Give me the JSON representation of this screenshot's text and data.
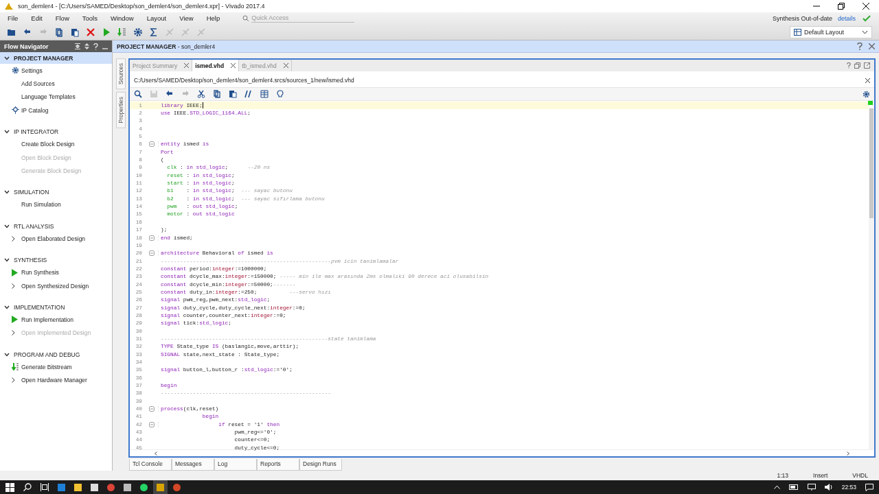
{
  "window": {
    "title": "son_demler4 - [C:/Users/SAMED/Desktop/son_demler4/son_demler4.xpr] - Vivado 2017.4"
  },
  "menu": [
    "File",
    "Edit",
    "Flow",
    "Tools",
    "Window",
    "Layout",
    "View",
    "Help"
  ],
  "quick_access": {
    "placeholder": "Quick Access"
  },
  "status": {
    "text": "Synthesis Out-of-date",
    "link": "details"
  },
  "layout_dropdown": {
    "value": "Default Layout"
  },
  "flow_navigator": {
    "title": "Flow Navigator",
    "sections": [
      {
        "title": "PROJECT MANAGER",
        "selected": true,
        "expanded": true,
        "items": [
          {
            "label": "Settings",
            "kind": "gear",
            "disabled": false
          },
          {
            "label": "Add Sources",
            "kind": "plain",
            "disabled": false
          },
          {
            "label": "Language Templates",
            "kind": "plain",
            "disabled": false
          },
          {
            "label": "IP Catalog",
            "kind": "ip",
            "disabled": false
          }
        ]
      },
      {
        "title": "IP INTEGRATOR",
        "selected": false,
        "expanded": true,
        "items": [
          {
            "label": "Create Block Design",
            "kind": "plain",
            "disabled": false
          },
          {
            "label": "Open Block Design",
            "kind": "plain",
            "disabled": true
          },
          {
            "label": "Generate Block Design",
            "kind": "plain",
            "disabled": true
          }
        ]
      },
      {
        "title": "SIMULATION",
        "selected": false,
        "expanded": true,
        "items": [
          {
            "label": "Run Simulation",
            "kind": "plain",
            "disabled": false
          }
        ]
      },
      {
        "title": "RTL ANALYSIS",
        "selected": false,
        "expanded": true,
        "items": [
          {
            "label": "Open Elaborated Design",
            "kind": "chevron",
            "disabled": false
          }
        ]
      },
      {
        "title": "SYNTHESIS",
        "selected": false,
        "expanded": true,
        "items": [
          {
            "label": "Run Synthesis",
            "kind": "play",
            "disabled": false
          },
          {
            "label": "Open Synthesized Design",
            "kind": "chevron",
            "disabled": false
          }
        ]
      },
      {
        "title": "IMPLEMENTATION",
        "selected": false,
        "expanded": true,
        "items": [
          {
            "label": "Run Implementation",
            "kind": "play",
            "disabled": false
          },
          {
            "label": "Open Implemented Design",
            "kind": "chevron",
            "disabled": true
          }
        ]
      },
      {
        "title": "PROGRAM AND DEBUG",
        "selected": false,
        "expanded": true,
        "items": [
          {
            "label": "Generate Bitstream",
            "kind": "bitstream",
            "disabled": false
          },
          {
            "label": "Open Hardware Manager",
            "kind": "chevron",
            "disabled": false
          }
        ]
      }
    ]
  },
  "panel": {
    "title": "**PROJECT MANAGER** - son_demler4"
  },
  "side_tabs": [
    "Sources",
    "Properties"
  ],
  "editor": {
    "tabs": [
      {
        "label": "Project Summary",
        "selected": false
      },
      {
        "label": "ismed.vhd",
        "selected": true
      },
      {
        "label": "tb_ismed.vhd",
        "selected": false
      }
    ],
    "path": "C:/Users/SAMED/Desktop/son_demler4/son_demler4.srcs/sources_1/new/ismed.vhd",
    "lines": [
      {
        "number": "1",
        "fold": false,
        "current": true,
        "tokens": [
          {
            "kind": "kw",
            "text": "library"
          },
          {
            "kind": "plain",
            "text": " IEEE;"
          }
        ]
      },
      {
        "number": "2",
        "fold": false,
        "current": false,
        "tokens": [
          {
            "kind": "kw",
            "text": "use"
          },
          {
            "kind": "plain",
            "text": " IEEE."
          },
          {
            "kind": "kw",
            "text": "STD_LOGIC_1164.ALL"
          },
          {
            "kind": "plain",
            "text": ";"
          }
        ]
      },
      {
        "number": "3",
        "fold": false,
        "current": false
      },
      {
        "number": "4",
        "fold": false,
        "current": false
      },
      {
        "number": "5",
        "fold": false,
        "current": false
      },
      {
        "number": "6",
        "fold": true,
        "current": false,
        "tokens": [
          {
            "kind": "kw",
            "text": "entity"
          },
          {
            "kind": "plain",
            "text": " ismed "
          },
          {
            "kind": "kw",
            "text": "is"
          }
        ]
      },
      {
        "number": "7",
        "fold": false,
        "current": false,
        "tokens": [
          {
            "kind": "kw",
            "text": "Port"
          }
        ]
      },
      {
        "number": "8",
        "fold": false,
        "current": false,
        "tokens": [
          {
            "kind": "plain",
            "text": "("
          }
        ]
      },
      {
        "number": "9",
        "fold": false,
        "current": false,
        "tokens": [
          {
            "kind": "port",
            "text": "  clk"
          },
          {
            "kind": "plain",
            "text": " : "
          },
          {
            "kind": "kw",
            "text": "in std_logic"
          },
          {
            "kind": "plain",
            "text": ";      "
          },
          {
            "kind": "comment",
            "text": "--20 ns"
          }
        ]
      },
      {
        "number": "10",
        "fold": false,
        "current": false,
        "tokens": [
          {
            "kind": "port",
            "text": "  reset"
          },
          {
            "kind": "plain",
            "text": " : "
          },
          {
            "kind": "kw",
            "text": "in std_logic"
          },
          {
            "kind": "plain",
            "text": ";"
          }
        ]
      },
      {
        "number": "11",
        "fold": false,
        "current": false,
        "tokens": [
          {
            "kind": "port",
            "text": "  start"
          },
          {
            "kind": "plain",
            "text": " : "
          },
          {
            "kind": "kw",
            "text": "in std_logic"
          },
          {
            "kind": "plain",
            "text": ";"
          }
        ]
      },
      {
        "number": "12",
        "fold": false,
        "current": false,
        "tokens": [
          {
            "kind": "port",
            "text": "  b1"
          },
          {
            "kind": "plain",
            "text": "    : "
          },
          {
            "kind": "kw",
            "text": "in std_logic"
          },
          {
            "kind": "plain",
            "text": ";  "
          },
          {
            "kind": "comment",
            "text": "--- sayac butonu"
          }
        ]
      },
      {
        "number": "13",
        "fold": false,
        "current": false,
        "tokens": [
          {
            "kind": "port",
            "text": "  b2"
          },
          {
            "kind": "plain",
            "text": "    : "
          },
          {
            "kind": "kw",
            "text": "in std_logic"
          },
          {
            "kind": "plain",
            "text": ";  "
          },
          {
            "kind": "comment",
            "text": "--- sayac sıfırlama butonu"
          }
        ]
      },
      {
        "number": "14",
        "fold": false,
        "current": false,
        "tokens": [
          {
            "kind": "port",
            "text": "  pwm"
          },
          {
            "kind": "plain",
            "text": "   : "
          },
          {
            "kind": "kw",
            "text": "out std_logic"
          },
          {
            "kind": "plain",
            "text": ";"
          }
        ]
      },
      {
        "number": "15",
        "fold": false,
        "current": false,
        "tokens": [
          {
            "kind": "port",
            "text": "  motor"
          },
          {
            "kind": "plain",
            "text": " : "
          },
          {
            "kind": "kw",
            "text": "out std_logic"
          }
        ]
      },
      {
        "number": "16",
        "fold": false,
        "current": false
      },
      {
        "number": "17",
        "fold": false,
        "current": false,
        "tokens": [
          {
            "kind": "plain",
            "text": ");"
          }
        ]
      },
      {
        "number": "18",
        "fold": true,
        "current": false,
        "tokens": [
          {
            "kind": "kw",
            "text": "end"
          },
          {
            "kind": "plain",
            "text": " ismed;"
          }
        ]
      },
      {
        "number": "19",
        "fold": false,
        "current": false
      },
      {
        "number": "20",
        "fold": true,
        "current": false,
        "tokens": [
          {
            "kind": "kw",
            "text": "architecture"
          },
          {
            "kind": "plain",
            "text": " Behavioral "
          },
          {
            "kind": "kw",
            "text": "of"
          },
          {
            "kind": "plain",
            "text": " ismed "
          },
          {
            "kind": "kw",
            "text": "is"
          }
        ]
      },
      {
        "number": "21",
        "fold": false,
        "current": false,
        "tokens": [
          {
            "kind": "comment",
            "text": "-----------------------------------------------------pvm icin tanimlamalar"
          }
        ]
      },
      {
        "number": "22",
        "fold": false,
        "current": false,
        "tokens": [
          {
            "kind": "kw",
            "text": "constant"
          },
          {
            "kind": "plain",
            "text": " period:"
          },
          {
            "kind": "type",
            "text": "integer"
          },
          {
            "kind": "plain",
            "text": ":=1000000;"
          }
        ]
      },
      {
        "number": "23",
        "fold": false,
        "current": false,
        "tokens": [
          {
            "kind": "kw",
            "text": "constant"
          },
          {
            "kind": "plain",
            "text": " dcycle_max:"
          },
          {
            "kind": "type",
            "text": "integer"
          },
          {
            "kind": "plain",
            "text": ":=150000; "
          },
          {
            "kind": "comment",
            "text": "----- min ile max arasında 2ms olmalıki 90 derece aci olusabilsin"
          }
        ]
      },
      {
        "number": "24",
        "fold": false,
        "current": false,
        "tokens": [
          {
            "kind": "kw",
            "text": "constant"
          },
          {
            "kind": "plain",
            "text": " dcycle_min:"
          },
          {
            "kind": "type",
            "text": "integer"
          },
          {
            "kind": "plain",
            "text": ":=50000;"
          },
          {
            "kind": "comment",
            "text": "-------"
          }
        ]
      },
      {
        "number": "25",
        "fold": false,
        "current": false,
        "tokens": [
          {
            "kind": "kw",
            "text": "constant"
          },
          {
            "kind": "plain",
            "text": " duty_in:"
          },
          {
            "kind": "type",
            "text": "integer"
          },
          {
            "kind": "plain",
            "text": ":=250;          "
          },
          {
            "kind": "comment",
            "text": "---servo hızı"
          }
        ]
      },
      {
        "number": "26",
        "fold": false,
        "current": false,
        "tokens": [
          {
            "kind": "kw",
            "text": "signal"
          },
          {
            "kind": "plain",
            "text": " pwm_reg,pwm_next:"
          },
          {
            "kind": "kw",
            "text": "std_logic"
          },
          {
            "kind": "plain",
            "text": ";"
          }
        ]
      },
      {
        "number": "27",
        "fold": false,
        "current": false,
        "tokens": [
          {
            "kind": "kw",
            "text": "signal"
          },
          {
            "kind": "plain",
            "text": " duty_cycle,duty_cycle_next:"
          },
          {
            "kind": "type",
            "text": "integer"
          },
          {
            "kind": "plain",
            "text": ":=0;"
          }
        ]
      },
      {
        "number": "28",
        "fold": false,
        "current": false,
        "tokens": [
          {
            "kind": "kw",
            "text": "signal"
          },
          {
            "kind": "plain",
            "text": " counter,counter_next:"
          },
          {
            "kind": "type",
            "text": "integer"
          },
          {
            "kind": "plain",
            "text": ":=0;"
          }
        ]
      },
      {
        "number": "29",
        "fold": false,
        "current": false,
        "tokens": [
          {
            "kind": "kw",
            "text": "signal"
          },
          {
            "kind": "plain",
            "text": " tick:"
          },
          {
            "kind": "kw",
            "text": "std_logic"
          },
          {
            "kind": "plain",
            "text": ";"
          }
        ]
      },
      {
        "number": "30",
        "fold": false,
        "current": false
      },
      {
        "number": "31",
        "fold": false,
        "current": false,
        "tokens": [
          {
            "kind": "comment",
            "text": "----------------------------------------------------state tanimlama"
          }
        ]
      },
      {
        "number": "32",
        "fold": false,
        "current": false,
        "tokens": [
          {
            "kind": "kw",
            "text": "TYPE"
          },
          {
            "kind": "plain",
            "text": " State_type "
          },
          {
            "kind": "kw",
            "text": "IS"
          },
          {
            "kind": "plain",
            "text": " (baslangic,move,arttir);"
          }
        ]
      },
      {
        "number": "33",
        "fold": false,
        "current": false,
        "tokens": [
          {
            "kind": "kw",
            "text": "SIGNAL"
          },
          {
            "kind": "plain",
            "text": " state,next_state : State_type;"
          }
        ]
      },
      {
        "number": "34",
        "fold": false,
        "current": false
      },
      {
        "number": "35",
        "fold": false,
        "current": false,
        "tokens": [
          {
            "kind": "kw",
            "text": "signal"
          },
          {
            "kind": "plain",
            "text": " button_l,button_r :"
          },
          {
            "kind": "kw",
            "text": "std_logic"
          },
          {
            "kind": "plain",
            "text": ":='0';"
          }
        ]
      },
      {
        "number": "36",
        "fold": false,
        "current": false
      },
      {
        "number": "37",
        "fold": false,
        "current": false,
        "tokens": [
          {
            "kind": "kw",
            "text": "begin"
          }
        ]
      },
      {
        "number": "38",
        "fold": false,
        "current": false,
        "tokens": [
          {
            "kind": "comment",
            "text": "-----------------------------------------------------"
          }
        ]
      },
      {
        "number": "39",
        "fold": false,
        "current": false
      },
      {
        "number": "40",
        "fold": true,
        "current": false,
        "tokens": [
          {
            "kind": "kw",
            "text": "process"
          },
          {
            "kind": "plain",
            "text": "(clk,reset)"
          }
        ]
      },
      {
        "number": "41",
        "fold": false,
        "current": false,
        "tokens": [
          {
            "kind": "kw",
            "text": "             begin"
          }
        ]
      },
      {
        "number": "42",
        "fold": true,
        "current": false,
        "tokens": [
          {
            "kind": "kw",
            "text": "                  if"
          },
          {
            "kind": "plain",
            "text": " reset = '1' "
          },
          {
            "kind": "kw",
            "text": "then"
          }
        ]
      },
      {
        "number": "43",
        "fold": false,
        "current": false,
        "tokens": [
          {
            "kind": "plain",
            "text": "                       pwm_reg<='0';"
          }
        ]
      },
      {
        "number": "44",
        "fold": false,
        "current": false,
        "tokens": [
          {
            "kind": "plain",
            "text": "                       counter<=0;"
          }
        ]
      },
      {
        "number": "45",
        "fold": false,
        "current": false,
        "tokens": [
          {
            "kind": "plain",
            "text": "                       duty_cycle<=0;"
          }
        ]
      }
    ]
  },
  "bottom_tabs": [
    "Tcl Console",
    "Messages",
    "Log",
    "Reports",
    "Design Runs"
  ],
  "status_bar": {
    "position": "1:13",
    "mode": "Insert",
    "language": "VHDL"
  },
  "taskbar": {
    "clock": "22:53"
  }
}
